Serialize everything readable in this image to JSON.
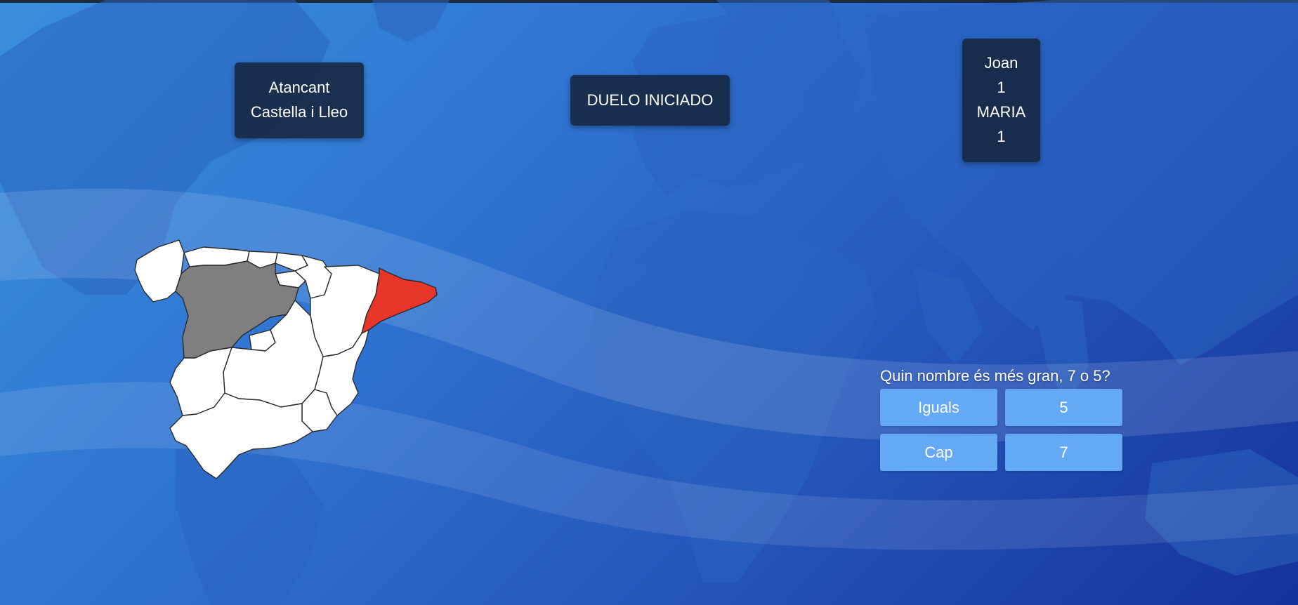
{
  "attack": {
    "line1": "Atancant",
    "line2": "Castella i Lleo"
  },
  "duel": {
    "status": "DUELO INICIADO"
  },
  "scoreboard": {
    "player1_name": "Joan",
    "player1_score": "1",
    "player2_name": "MARIA",
    "player2_score": "1"
  },
  "question": {
    "text": "Quin nombre és més gran, 7 o 5?",
    "answers": [
      "Iguals",
      "5",
      "Cap",
      "7"
    ]
  },
  "map": {
    "attacking_region_color": "#e8352a",
    "target_region_color": "#7f7f7f",
    "neutral_region_color": "#ffffff"
  },
  "colors": {
    "panel_bg": "#16263e",
    "answer_bg": "#63a9f4"
  }
}
